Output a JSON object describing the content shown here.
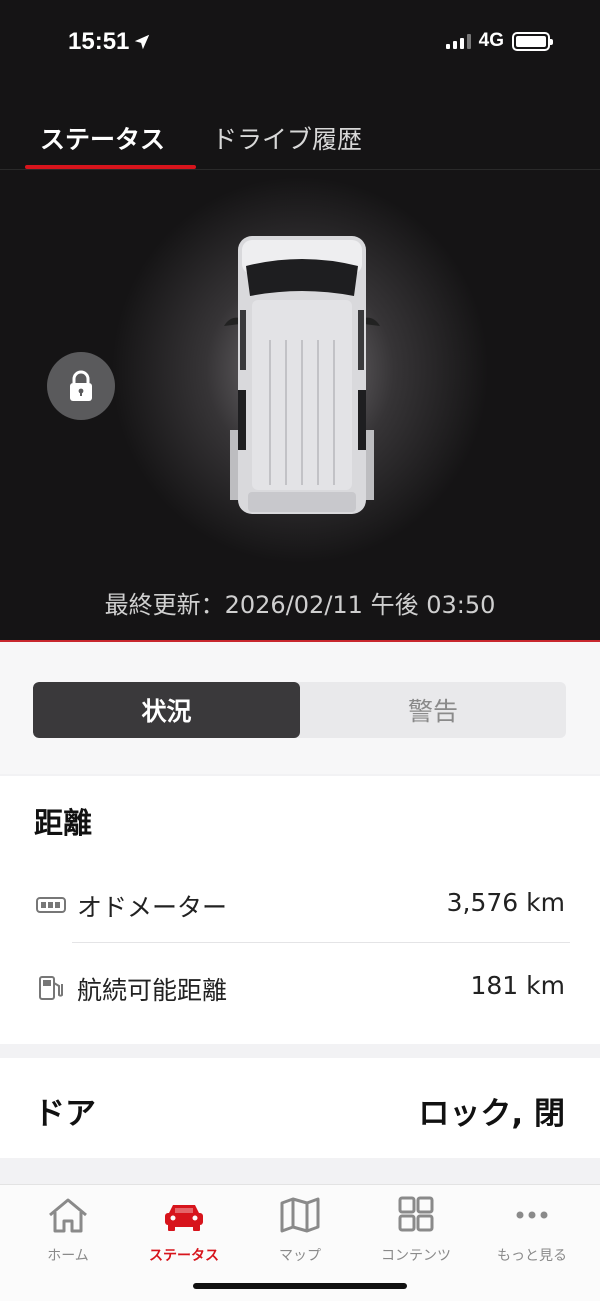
{
  "status_bar": {
    "time": "15:51",
    "network": "4G"
  },
  "tabs": [
    {
      "label": "ステータス",
      "active": true
    },
    {
      "label": "ドライブ履歴",
      "active": false
    }
  ],
  "vehicle": {
    "last_updated": "最終更新：2026/02/11 午後 03:50",
    "lock_icon": "lock-icon"
  },
  "segment": {
    "active_label": "状況",
    "inactive_label": "警告"
  },
  "distance": {
    "title": "距離",
    "odometer": {
      "label": "オドメーター",
      "value": "3,576 km",
      "icon": "odometer-icon"
    },
    "range": {
      "label": "航続可能距離",
      "value": "181 km",
      "icon": "fuel-pump-icon"
    }
  },
  "door": {
    "title": "ドア",
    "value": "ロック, 閉"
  },
  "bottom_nav": [
    {
      "label": "ホーム",
      "icon": "home-icon",
      "active": false
    },
    {
      "label": "ステータス",
      "icon": "car-icon",
      "active": true
    },
    {
      "label": "マップ",
      "icon": "map-icon",
      "active": false
    },
    {
      "label": "コンテンツ",
      "icon": "grid-icon",
      "active": false
    },
    {
      "label": "もっと見る",
      "icon": "more-icon",
      "active": false
    }
  ],
  "colors": {
    "accent": "#d7141c",
    "dark_bg": "#151415",
    "light_bg": "#f2f2f4"
  }
}
